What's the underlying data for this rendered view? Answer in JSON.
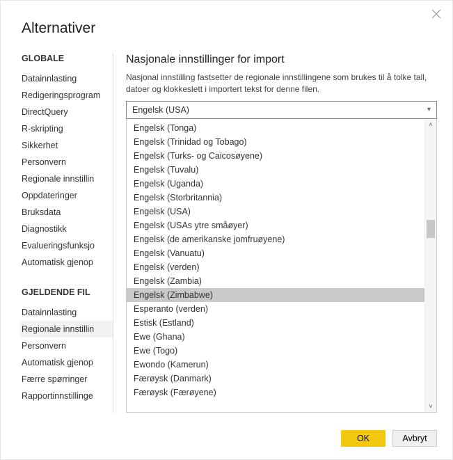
{
  "title": "Alternativer",
  "sidebar": {
    "section1": "GLOBALE",
    "items1": [
      {
        "label": "Datainnlasting"
      },
      {
        "label": "Redigeringsprogram"
      },
      {
        "label": "DirectQuery"
      },
      {
        "label": "R-skripting"
      },
      {
        "label": "Sikkerhet"
      },
      {
        "label": "Personvern"
      },
      {
        "label": "Regionale innstillin"
      },
      {
        "label": "Oppdateringer"
      },
      {
        "label": "Bruksdata"
      },
      {
        "label": "Diagnostikk"
      },
      {
        "label": "Evalueringsfunksjo"
      },
      {
        "label": "Automatisk gjenop"
      }
    ],
    "section2": "GJELDENDE FIL",
    "items2": [
      {
        "label": "Datainnlasting"
      },
      {
        "label": "Regionale innstillin",
        "active": true
      },
      {
        "label": "Personvern"
      },
      {
        "label": "Automatisk gjenop"
      },
      {
        "label": "Færre spørringer"
      },
      {
        "label": "Rapportinnstillinge"
      }
    ]
  },
  "main": {
    "heading": "Nasjonale innstillinger for import",
    "desc": "Nasjonal innstilling fastsetter de regionale innstillingene som brukes til å tolke tall, datoer og klokkeslett i importert tekst for denne filen.",
    "selected": "Engelsk (USA)"
  },
  "options": [
    "Engelsk (Tonga)",
    "Engelsk (Trinidad og Tobago)",
    "Engelsk (Turks- og Caicosøyene)",
    "Engelsk (Tuvalu)",
    "Engelsk (Uganda)",
    "Engelsk (Storbritannia)",
    "Engelsk (USA)",
    "Engelsk (USAs ytre småøyer)",
    "Engelsk (de amerikanske jomfruøyene)",
    "Engelsk (Vanuatu)",
    "Engelsk (verden)",
    "Engelsk (Zambia)",
    "Engelsk (Zimbabwe)",
    "Esperanto (verden)",
    "Estisk (Estland)",
    "Ewe (Ghana)",
    "Ewe (Togo)",
    "Ewondo (Kamerun)",
    "Færøysk (Danmark)",
    "Færøysk (Færøyene)"
  ],
  "selectedOption": "Engelsk (Zimbabwe)",
  "buttons": {
    "ok": "OK",
    "cancel": "Avbryt"
  }
}
